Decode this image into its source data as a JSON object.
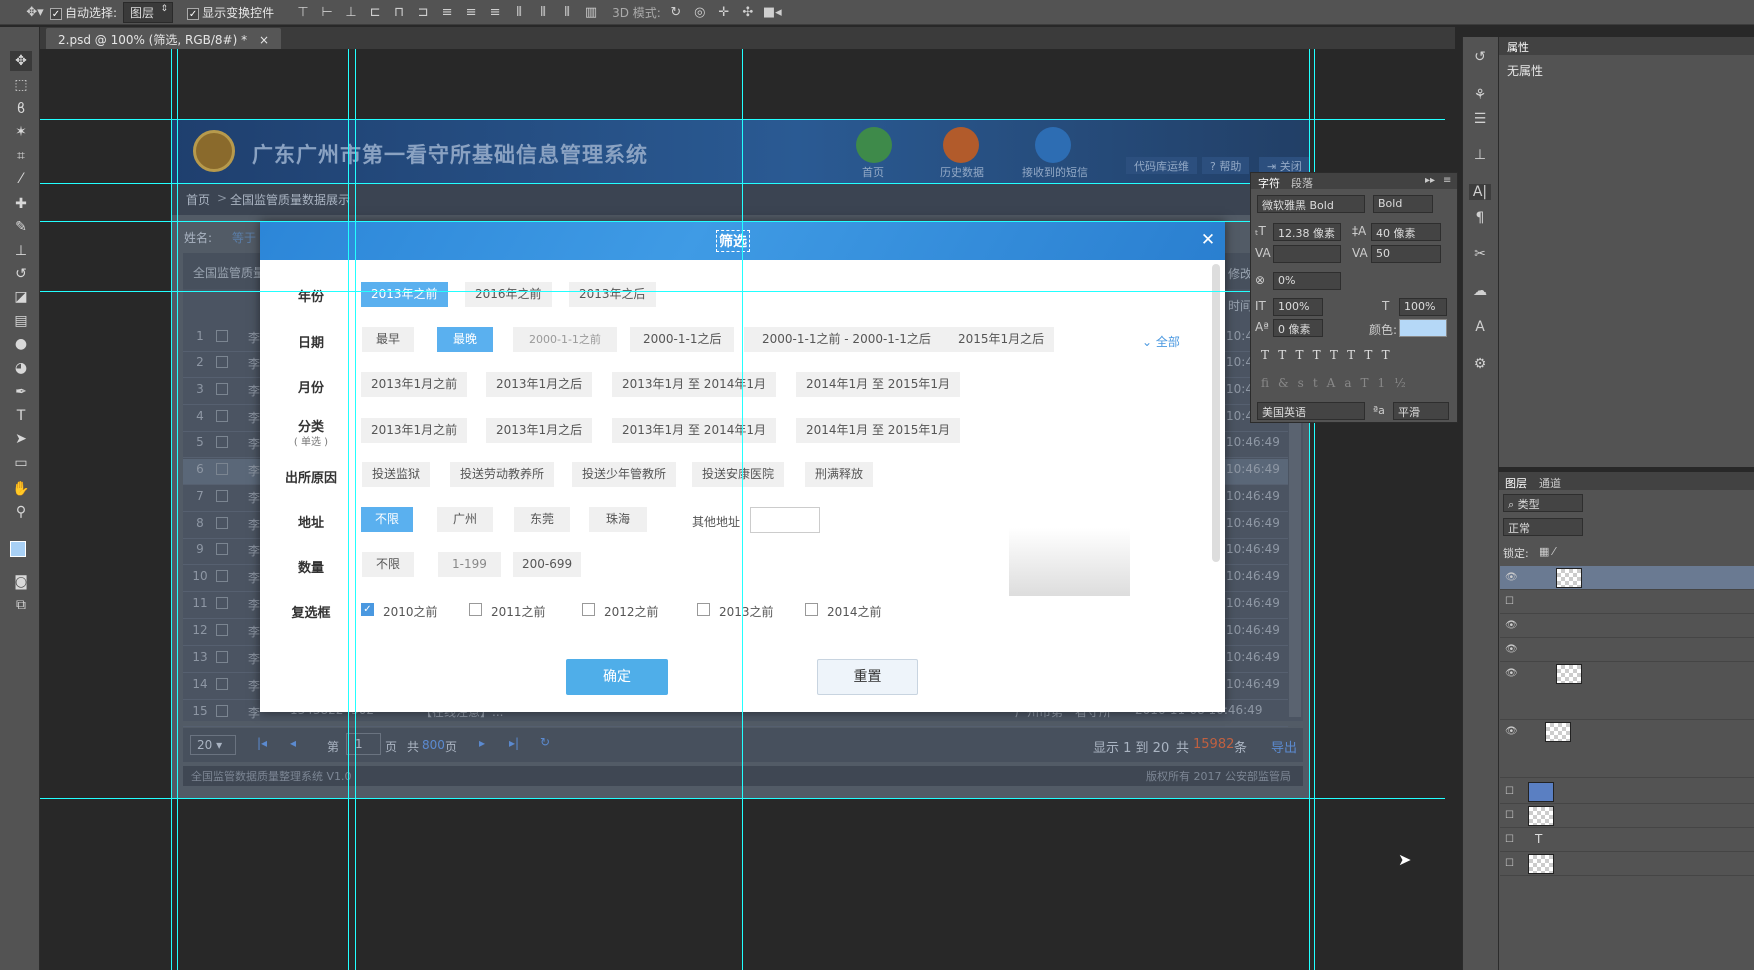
{
  "options_bar": {
    "auto_select_label": "自动选择:",
    "auto_select_value": "图层",
    "transform_label": "显示变换控件",
    "mode_3d_label": "3D 模式:"
  },
  "doc_tab": {
    "title": "2.psd @ 100% (筛选, RGB/8#) *",
    "close": "×"
  },
  "page": {
    "system_title": "广东广州市第一看守所基础信息管理系统",
    "nav": [
      "首页",
      "历史数据",
      "接收到的短信"
    ],
    "header_buttons": [
      "代码库运维",
      "帮助",
      "关闭"
    ],
    "help_icon": "?",
    "breadcrumb": {
      "home": "首页",
      "sep": ">",
      "current": "全国监管质量数据展示"
    },
    "name_label": "姓名:",
    "name_op": "等于",
    "section_title": "全国监管质量",
    "edit_label": "修改",
    "time_col": "时间",
    "rows": [
      "1",
      "2",
      "3",
      "4",
      "5",
      "6",
      "7",
      "8",
      "9",
      "10",
      "11",
      "12",
      "13",
      "14",
      "15"
    ],
    "row_name": "李",
    "row_times": [
      "10:46:49",
      "10:46:49",
      "10:46:49",
      "10:46:49",
      "10:46:49",
      "10:46:49",
      "10:46:49",
      "10:46:49",
      "10:46:49",
      "10:46:49",
      "10:46:49",
      "10:46:49",
      "10:46:49",
      "10:46:49",
      "10:46:49"
    ],
    "last_row": {
      "phone": "13438224302",
      "desc": "【在线注意】...",
      "org": "广州市第一看守所",
      "date": "2016-11-08 10:46:49"
    },
    "pager": {
      "size": "20",
      "page_prefix": "第",
      "page_value": "1",
      "page_suffix": "页",
      "total_prefix": "共",
      "total_pages": "800",
      "total_suffix": "页",
      "display": "显示 1 到 20",
      "total_label": "共",
      "total_count": "15982",
      "unit": "条",
      "export": "导出"
    },
    "footer_left": "全国监管数据质量整理系统 V1.0",
    "footer_right": "版权所有 2017 公安部监管局"
  },
  "modal": {
    "title": "筛选",
    "close": "✕",
    "year": {
      "label": "年份",
      "options": [
        "2013年之前",
        "2016年之前",
        "2013年之后"
      ]
    },
    "date": {
      "label": "日期",
      "options": [
        "最早",
        "最晚",
        "2000-1-1之前",
        "2000-1-1之后",
        "2000-1-1之前 - 2000-1-1之后",
        "2015年1月之后"
      ],
      "all": "全部"
    },
    "month": {
      "label": "月份",
      "options": [
        "2013年1月之前",
        "2013年1月之后",
        "2013年1月 至 2014年1月",
        "2014年1月 至 2015年1月"
      ]
    },
    "category": {
      "label": "分类",
      "sublabel": "( 单选 )",
      "options": [
        "2013年1月之前",
        "2013年1月之后",
        "2013年1月 至 2014年1月",
        "2014年1月 至 2015年1月"
      ]
    },
    "reason": {
      "label": "出所原因",
      "options": [
        "投送监狱",
        "投送劳动教养所",
        "投送少年管教所",
        "投送安康医院",
        "刑满释放"
      ]
    },
    "address": {
      "label": "地址",
      "options": [
        "不限",
        "广州",
        "东莞",
        "珠海"
      ],
      "other_label": "其他地址"
    },
    "quantity": {
      "label": "数量",
      "options": [
        "不限",
        "1-199",
        "200-699"
      ]
    },
    "checkbox": {
      "label": "复选框",
      "options": [
        "2010之前",
        "2011之前",
        "2012之前",
        "2013之前",
        "2014之前"
      ]
    },
    "ok": "确定",
    "reset": "重置"
  },
  "panels": {
    "properties_tab": "属性",
    "no_props": "无属性",
    "char_tab": "字符",
    "para_tab": "段落",
    "font": "微软雅黑 Bold",
    "style": "Bold",
    "size": "12.38 像素",
    "leading": "40 像素",
    "tracking": "50",
    "scale_pct": "0%",
    "vscale": "100%",
    "hscale": "100%",
    "baseline": "0 像素",
    "color_label": "颜色:",
    "lang": "美国英语",
    "aa_label": "ªa",
    "aa": "平滑",
    "layers_tab": "图层",
    "channels_tab": "通道",
    "kind": "类型",
    "blend": "正常",
    "lock_label": "锁定:"
  },
  "colors": {
    "accent": "#5ab0ef",
    "guide": "#22ffff",
    "ps_bg": "#282828"
  }
}
